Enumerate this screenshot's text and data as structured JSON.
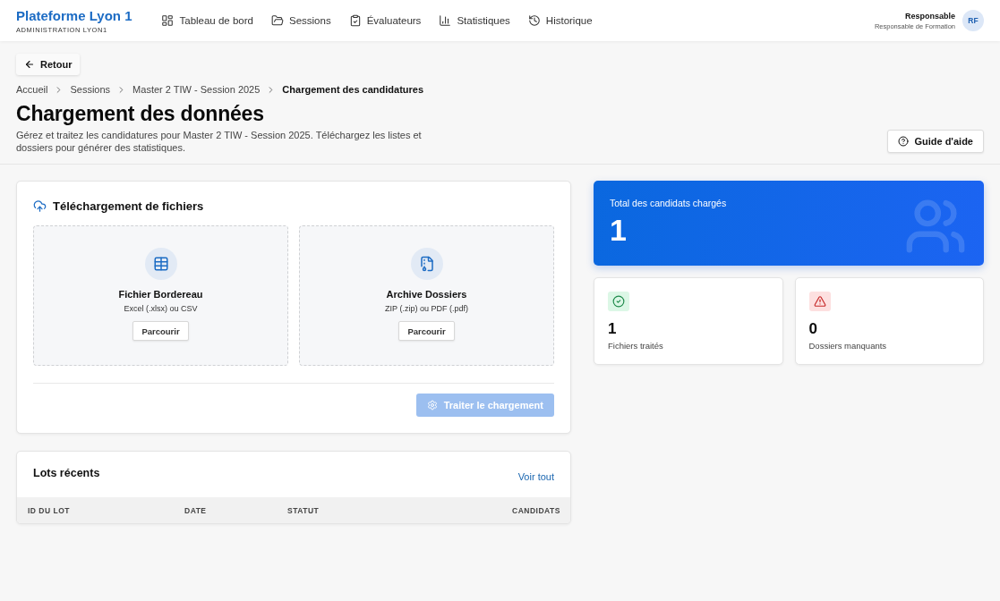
{
  "header": {
    "brand": {
      "title": "Plateforme Lyon 1",
      "subtitle": "ADMINISTRATION LYON1"
    },
    "nav": [
      {
        "label": "Tableau de bord",
        "selected": false
      },
      {
        "label": "Sessions",
        "selected": false
      },
      {
        "label": "Évaluateurs",
        "selected": false
      },
      {
        "label": "Statistiques",
        "selected": false
      },
      {
        "label": "Historique",
        "selected": false
      }
    ],
    "user": {
      "name": "Responsable",
      "role": "Responsable de Formation",
      "initials": "RF"
    }
  },
  "back_button": "Retour",
  "breadcrumb": [
    {
      "label": "Accueil",
      "current": false
    },
    {
      "label": "Sessions",
      "current": false
    },
    {
      "label": "Master 2 TIW - Session 2025",
      "current": false
    },
    {
      "label": "Chargement des candidatures",
      "current": true
    }
  ],
  "page": {
    "title": "Chargement des données",
    "description": "Gérez et traitez les candidatures pour Master 2 TIW - Session 2025. Téléchargez les listes et dossiers pour générer des statistiques.",
    "help_button": "Guide d'aide"
  },
  "upload": {
    "title": "Téléchargement de fichiers",
    "zones": [
      {
        "title": "Fichier Bordereau",
        "formats": "Excel (.xlsx) ou CSV",
        "button": "Parcourir"
      },
      {
        "title": "Archive Dossiers",
        "formats": "ZIP (.zip) ou PDF (.pdf)",
        "button": "Parcourir"
      }
    ],
    "process_button": {
      "label": "Traiter le chargement",
      "disabled": true
    }
  },
  "summary": {
    "label": "Total des candidats chargés",
    "value": "1"
  },
  "stats": [
    {
      "kind": "success",
      "value": "1",
      "label": "Fichiers traités"
    },
    {
      "kind": "warning",
      "value": "0",
      "label": "Dossiers manquants"
    }
  ],
  "recent": {
    "title": "Lots récents",
    "link": "Voir tout",
    "columns": [
      "ID DU LOT",
      "DATE",
      "STATUT",
      "CANDIDATS"
    ]
  }
}
